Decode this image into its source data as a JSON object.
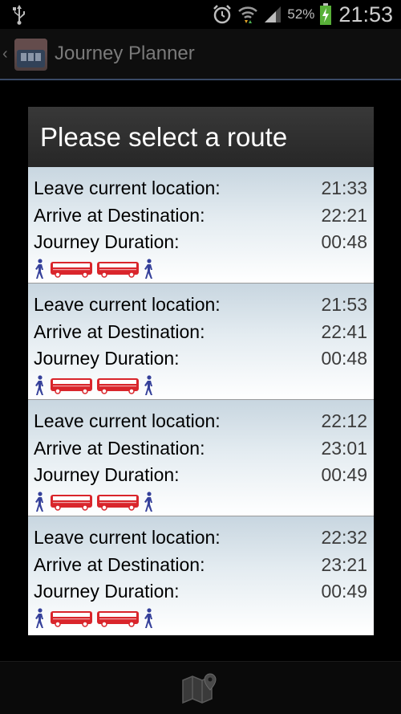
{
  "status_bar": {
    "battery_percent": "52%",
    "clock": "21:53",
    "icons": [
      "usb-icon",
      "alarm-icon",
      "wifi-icon",
      "signal-icon",
      "battery-charging-icon"
    ]
  },
  "action_bar": {
    "title": "Journey Planner",
    "icons": [
      "up-chevron-icon",
      "app-icon"
    ]
  },
  "dialog": {
    "title": "Please select a route",
    "labels": {
      "leave": "Leave current location:",
      "arrive": "Arrive at Destination:",
      "duration": "Journey Duration:"
    },
    "routes": [
      {
        "leave": "21:33",
        "arrive": "22:21",
        "duration": "00:48",
        "modes": [
          "walk",
          "bus",
          "bus",
          "walk"
        ]
      },
      {
        "leave": "21:53",
        "arrive": "22:41",
        "duration": "00:48",
        "modes": [
          "walk",
          "bus",
          "bus",
          "walk"
        ]
      },
      {
        "leave": "22:12",
        "arrive": "23:01",
        "duration": "00:49",
        "modes": [
          "walk",
          "bus",
          "bus",
          "walk"
        ]
      },
      {
        "leave": "22:32",
        "arrive": "23:21",
        "duration": "00:49",
        "modes": [
          "walk",
          "bus",
          "bus",
          "walk"
        ]
      }
    ]
  },
  "bottom_bar": {
    "icons": [
      "map-icon"
    ]
  },
  "colors": {
    "bus": "#d9252b",
    "walk": "#35409a",
    "route_bg_top": "#c8d6e0",
    "action_bar_divider": "#3a4a66"
  }
}
